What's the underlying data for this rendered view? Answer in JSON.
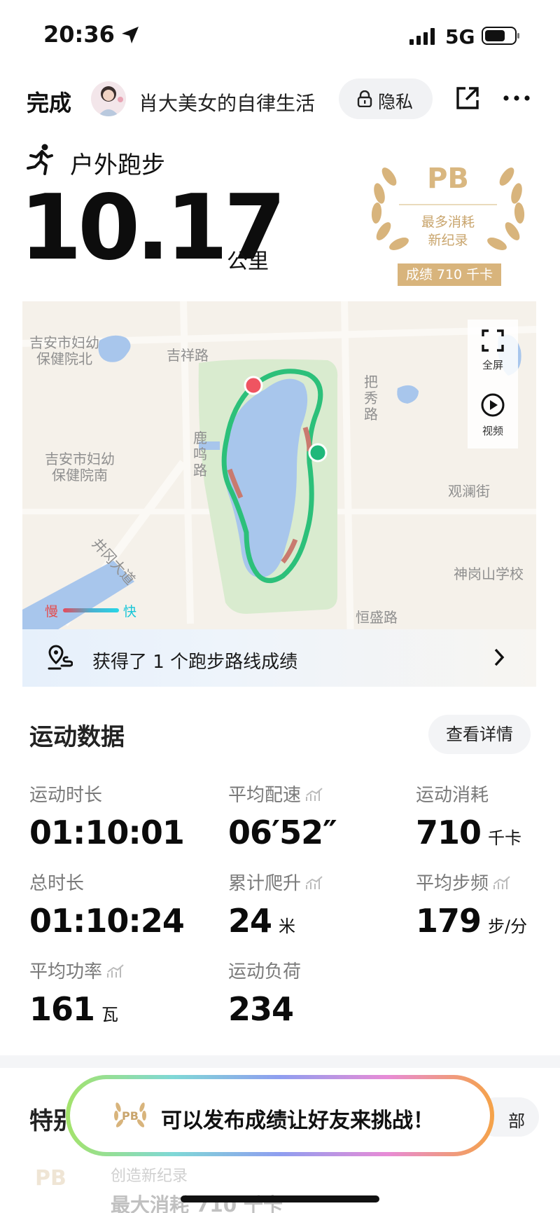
{
  "status_bar": {
    "time": "20:36",
    "network": "5G"
  },
  "header": {
    "done_label": "完成",
    "username": "肖大美女的自律生活",
    "privacy_label": "隐私"
  },
  "activity": {
    "type_label": "户外跑步",
    "distance": "10.17",
    "distance_unit": "公里"
  },
  "pb_badge": {
    "title": "PB",
    "line1": "最多消耗",
    "line2": "新纪录",
    "score": "成绩 710 千卡"
  },
  "map": {
    "labels": {
      "hospital_north": "吉安市妇幼\n保健院北",
      "jixiang_road": "吉祥路",
      "baxiu_road": "把\n秀\n路",
      "luming_road": "鹿\n鸣\n路",
      "hospital_south": "吉安市妇幼\n保健院南",
      "guanlan_street": "观澜街",
      "shengangshan_school": "神岗山学校",
      "avenue": "井冈大道",
      "hengsheng_road": "恒盛路"
    },
    "controls": {
      "fullscreen_label": "全屏",
      "video_label": "视频"
    },
    "speed_legend": {
      "slow": "慢",
      "fast": "快"
    },
    "route_banner": "获得了 1 个跑步路线成绩"
  },
  "stats_section": {
    "title": "运动数据",
    "details_label": "查看详情",
    "items": [
      {
        "label": "运动时长",
        "value": "01:10:01",
        "unit": ""
      },
      {
        "label": "平均配速",
        "value": "06′52″",
        "unit": ""
      },
      {
        "label": "运动消耗",
        "value": "710",
        "unit": "千卡"
      },
      {
        "label": "总时长",
        "value": "01:10:24",
        "unit": ""
      },
      {
        "label": "累计爬升",
        "value": "24",
        "unit": "米"
      },
      {
        "label": "平均步频",
        "value": "179",
        "unit": "步/分"
      },
      {
        "label": "平均功率",
        "value": "161",
        "unit": "瓦"
      },
      {
        "label": "运动负荷",
        "value": "234",
        "unit": ""
      }
    ]
  },
  "special_section": {
    "title": "特别",
    "all_label": "部",
    "faded_line1": "创造新纪录",
    "faded_line2": "最大消耗 710 千卡"
  },
  "toast": {
    "text": "可以发布成绩让好友来挑战！",
    "badge": "PB"
  }
}
